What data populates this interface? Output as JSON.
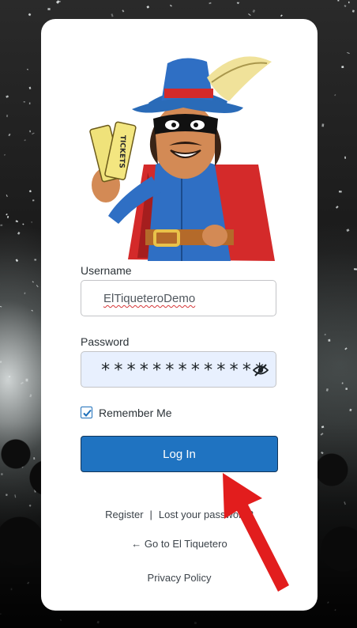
{
  "form": {
    "username_label": "Username",
    "username_value": "ElTiqueteroDemo",
    "password_label": "Password",
    "password_masked": "*************",
    "remember_label": "Remember Me",
    "remember_checked": true,
    "login_button": "Log In"
  },
  "links": {
    "register": "Register",
    "separator": "|",
    "lost_password": "Lost your password?",
    "back_to_site": "← Go to El Tiquetero",
    "privacy_policy": "Privacy Policy"
  },
  "mascot": {
    "ticket_text": "TICKETS"
  },
  "colors": {
    "accent": "#1f73c1",
    "arrow": "#e21d1d",
    "card": "#ffffff",
    "password_bg": "#e8f0fe"
  },
  "icons": {
    "password_toggle": "eye-slash-icon",
    "checkbox": "checkmark-icon"
  }
}
